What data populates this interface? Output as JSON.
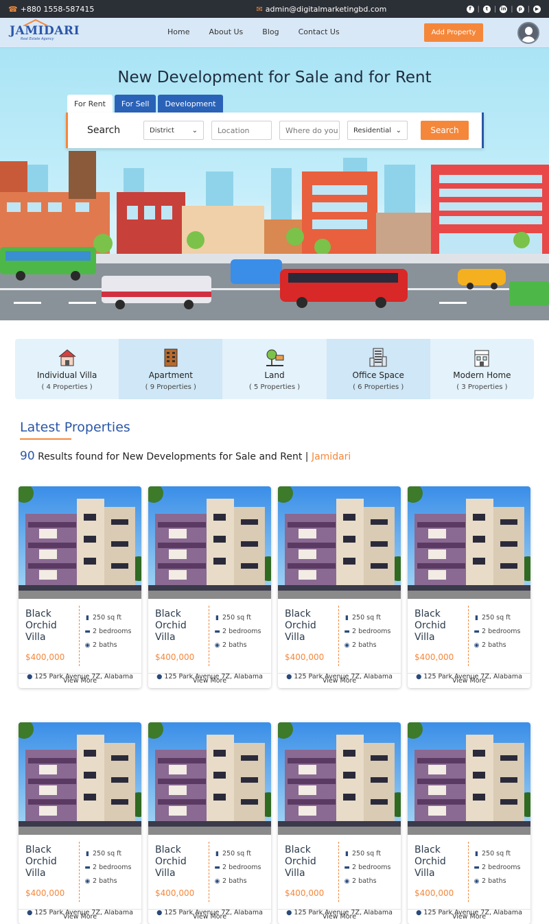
{
  "topbar": {
    "phone": "+880 1558-587415",
    "email": "admin@digitalmarketingbd.com",
    "socials": [
      "facebook-icon",
      "twitter-icon",
      "linkedin-icon",
      "pinterest-icon",
      "youtube-icon"
    ]
  },
  "nav": {
    "logo_text": "JAMIDARI",
    "logo_sub": "Real Estate Agency",
    "menu": [
      "Home",
      "About Us",
      "Blog",
      "Contact Us"
    ],
    "add_property": "Add Property"
  },
  "hero": {
    "title": "New Development for Sale and for Rent",
    "tabs": [
      "For Rent",
      "For Sell",
      "Development"
    ],
    "search_label": "Search",
    "district": "District",
    "location_placeholder": "Location",
    "where_placeholder": "Where do you",
    "type": "Residential",
    "search_button": "Search"
  },
  "categories": [
    {
      "name": "Individual Villa",
      "count": "( 4 Properties )",
      "icon": "villa-icon"
    },
    {
      "name": "Apartment",
      "count": "( 9 Properties )",
      "icon": "apartment-icon"
    },
    {
      "name": "Land",
      "count": "( 5 Properties )",
      "icon": "land-icon"
    },
    {
      "name": "Office Space",
      "count": "( 6 Properties )",
      "icon": "office-icon"
    },
    {
      "name": "Modern Home",
      "count": "( 3 Properties )",
      "icon": "modern-home-icon"
    }
  ],
  "latest": {
    "title": "Latest Properties",
    "count": "90",
    "results_text": " Results found for New Developments for Sale and Rent | ",
    "brand": "Jamidari"
  },
  "card": {
    "title_line1": "Black",
    "title_line2": "Orchid",
    "title_line3": "Villa",
    "price": "$400,000",
    "area": "250 sq ft",
    "bedrooms": "2 bedrooms",
    "baths": "2 baths",
    "address": "125 Park Avenue 7Z, Alabama",
    "view_more": "View More"
  },
  "colors": {
    "accent": "#f5873b",
    "brand": "#2a56a8",
    "topbar": "#2b2f36"
  }
}
